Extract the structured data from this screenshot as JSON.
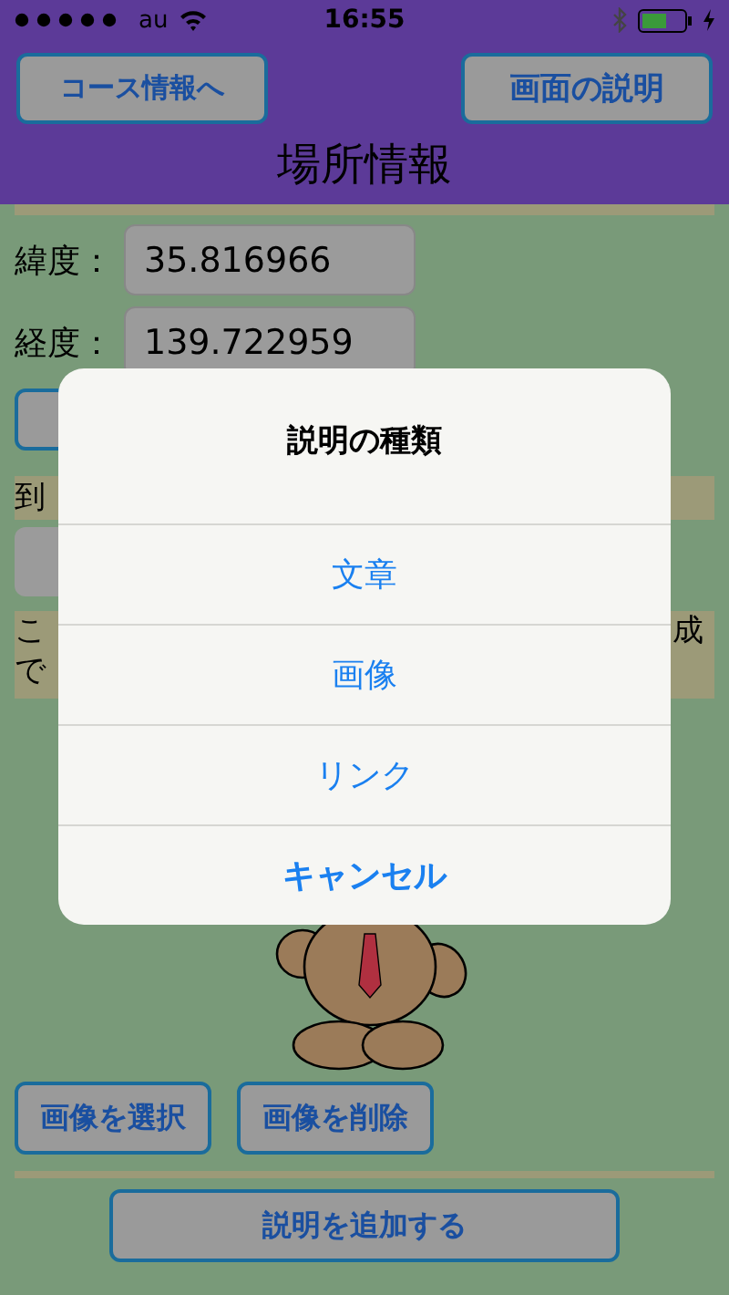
{
  "status_bar": {
    "carrier": "au",
    "time": "16:55"
  },
  "header": {
    "buttons": [
      "コース情報へ",
      "画面の説明"
    ],
    "title": "場所情報"
  },
  "fields": [
    {
      "label": "緯度：",
      "value": "35.816966"
    },
    {
      "label": "経度：",
      "value": "139.722959"
    }
  ],
  "section_label": "到",
  "paragraph": {
    "left_lines": [
      "こ",
      "で"
    ],
    "right_text": "成"
  },
  "image_buttons": [
    "画像を選択",
    "画像を削除"
  ],
  "add_button": "説明を追加する",
  "action_sheet": {
    "title": "説明の種類",
    "actions": [
      {
        "label": "文章",
        "kind": "default"
      },
      {
        "label": "画像",
        "kind": "default"
      },
      {
        "label": "リンク",
        "kind": "default"
      },
      {
        "label": "キャンセル",
        "kind": "cancel"
      }
    ]
  }
}
